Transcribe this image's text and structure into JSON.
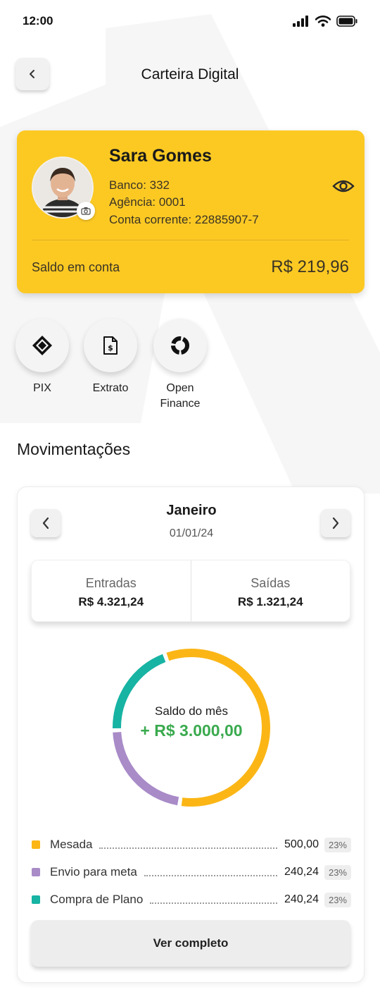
{
  "status_bar": {
    "time": "12:00"
  },
  "header": {
    "title": "Carteira Digital"
  },
  "account": {
    "holder": "Sara Gomes",
    "bank": "Banco: 332",
    "agency": "Agência: 0001",
    "account": "Conta corrente: 22885907-7",
    "balance_label": "Saldo em conta",
    "balance_value": "R$ 219,96"
  },
  "actions": [
    {
      "label": "PIX",
      "icon": "pix-icon"
    },
    {
      "label": "Extrato",
      "icon": "receipt-icon"
    },
    {
      "label": "Open Finance",
      "icon": "open-finance-icon"
    }
  ],
  "movements": {
    "section_title": "Movimentações",
    "month": "Janeiro",
    "date": "01/01/24",
    "income_label": "Entradas",
    "income_value": "R$ 4.321,24",
    "expense_label": "Saídas",
    "expense_value": "R$ 1.321,24",
    "summary_title": "Saldo do mês",
    "summary_value": "+ R$ 3.000,00",
    "items": [
      {
        "name": "Mesada",
        "amount": "500,00",
        "pct": "23%",
        "color": "#fbb616",
        "share": 0.58
      },
      {
        "name": "Envio para meta",
        "amount": "240,24",
        "pct": "23%",
        "color": "#a98bc8",
        "share": 0.22
      },
      {
        "name": "Compra de Plano",
        "amount": "240,24",
        "pct": "23%",
        "color": "#17b3a3",
        "share": 0.2
      }
    ],
    "see_more": "Ver completo"
  },
  "colors": {
    "accent": "#fcc923",
    "positive": "#3aaa4e"
  }
}
